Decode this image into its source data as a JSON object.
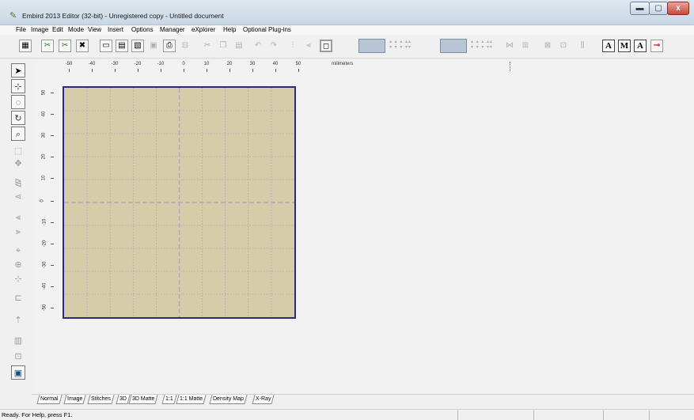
{
  "window": {
    "title": "Embird 2013 Editor (32-bit) - Unregistered copy - Untitled document",
    "controls": {
      "minimize": "▬",
      "maximize": "▢",
      "close": "x"
    }
  },
  "menu": [
    "File",
    "Image",
    "Edit",
    "Mode",
    "View",
    "Insert",
    "Options",
    "Manager",
    "eXplorer",
    "Help",
    "Optional Plug-ins"
  ],
  "toolbar": {
    "letter_buttons": [
      "A",
      "M",
      "A"
    ]
  },
  "ruler": {
    "top_labels": [
      "-50",
      "-40",
      "-30",
      "-20",
      "-10",
      "0",
      "10",
      "20",
      "30",
      "40",
      "50"
    ],
    "unit": "milimeters",
    "left_labels": [
      "50",
      "40",
      "30",
      "20",
      "10",
      "0",
      "-10",
      "-20",
      "-30",
      "-40",
      "-50"
    ]
  },
  "tabs": [
    "Normal",
    "Image",
    "Stitches",
    "3D",
    "3D Matte",
    "1:1",
    "1:1 Matte",
    "Density Map",
    "X-Ray"
  ],
  "active_tab": "Normal",
  "status": {
    "text": "Ready. For Help, press F1."
  },
  "colors": {
    "hoop_fill": "#d6ccaa",
    "hoop_border": "#27297a",
    "grid_line": "#a9a4b8"
  }
}
